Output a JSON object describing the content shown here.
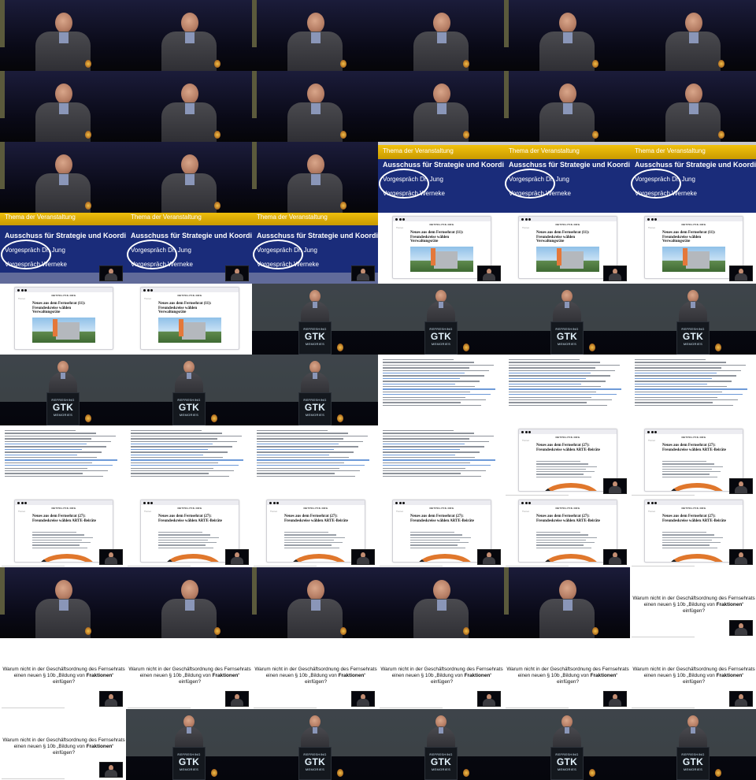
{
  "slide": {
    "category": "Thema der Veranstaltung",
    "line1": "Ausschuss für Strategie und Koordinierung",
    "line2": "Vorgespräch Dr. Jung",
    "line3": "Vorgespräch Werneke"
  },
  "lectern": {
    "top": "REFRESHING",
    "mid": "GTK",
    "bottom": "MEMORIES"
  },
  "web": {
    "site_name": "NETPOLITIK.ORG",
    "nav": "Themen",
    "headline_1": "Neues aus dem Fernsehrat (11): Freundeskreise wählen Verwaltungsräte",
    "headline_2": "Neues aus dem Fernsehrat (27): Freundeskreise wählen ARTE-Beiräte"
  },
  "question": {
    "before": "Warum nicht in der Geschäftsordnung des Fernsehrats einen neuen § 10b „Bildung von ",
    "bold": "Fraktionen",
    "after": "“ einfügen?"
  },
  "tiles": [
    "close",
    "close",
    "close",
    "close",
    "close",
    "close",
    "close",
    "close",
    "close",
    "close",
    "close",
    "close",
    "close",
    "close",
    "close",
    "slide",
    "slide",
    "slide",
    "slide2",
    "slide2",
    "slide2",
    "web1",
    "web1",
    "web1",
    "web1b",
    "web1b",
    "wide",
    "wide",
    "wide",
    "wide",
    "wide",
    "wide",
    "wide",
    "text",
    "text",
    "text",
    "text",
    "text",
    "text",
    "text",
    "web2top",
    "web2top",
    "web2",
    "web2",
    "web2",
    "web2",
    "web2",
    "web2",
    "close",
    "close",
    "close",
    "close",
    "close",
    "q",
    "q",
    "q",
    "q",
    "q",
    "q",
    "q",
    "q",
    "wide",
    "wide",
    "wide",
    "wide",
    "wide"
  ]
}
